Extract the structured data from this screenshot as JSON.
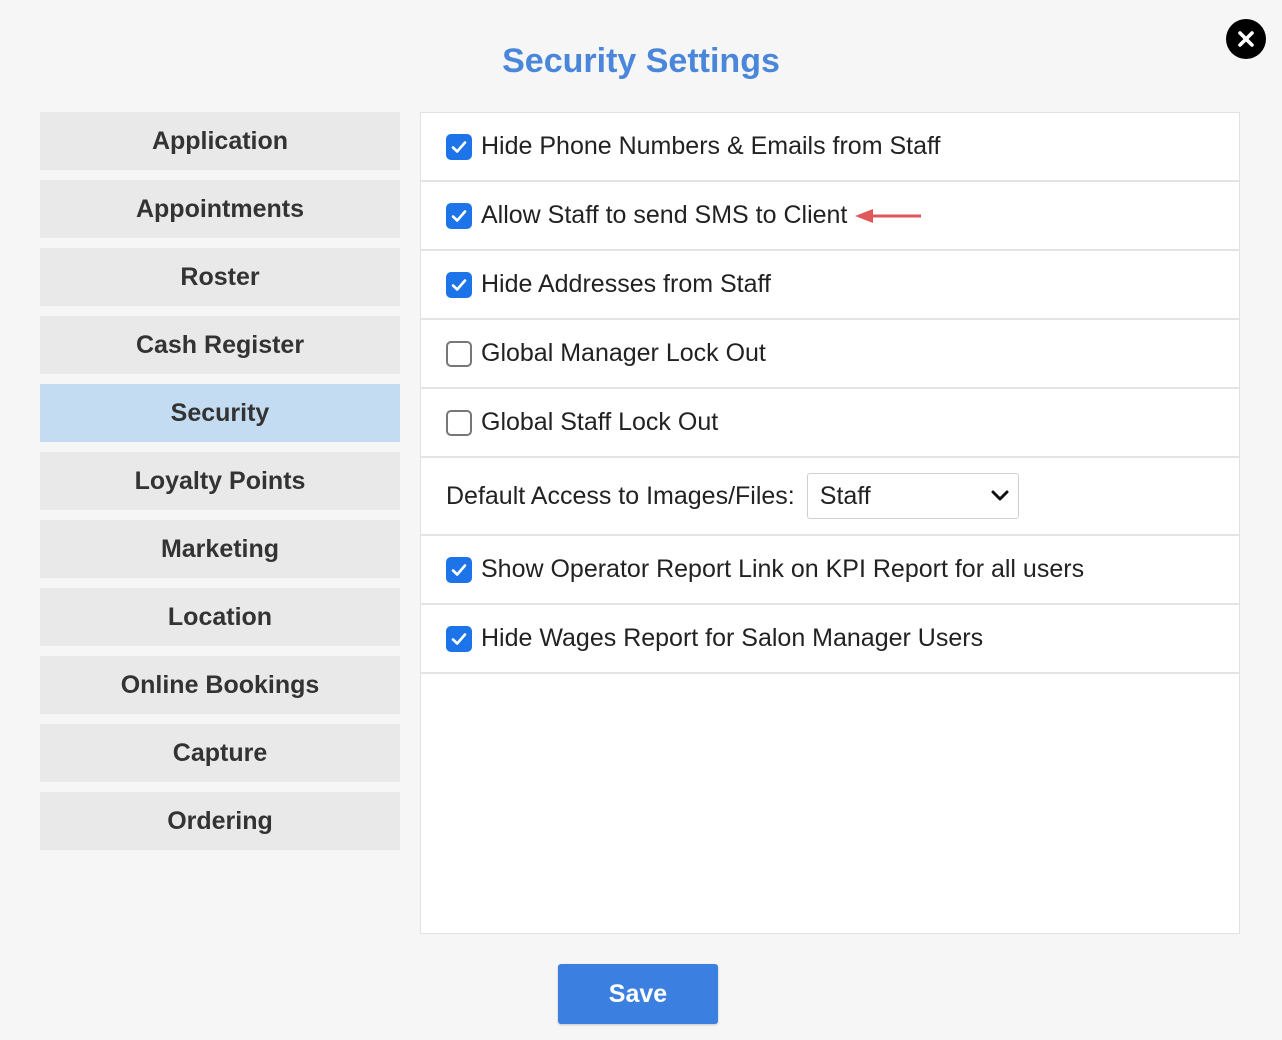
{
  "dialog": {
    "title": "Security Settings",
    "close_icon": "close-icon",
    "save_label": "Save"
  },
  "sidebar": {
    "items": [
      {
        "label": "Application",
        "active": false
      },
      {
        "label": "Appointments",
        "active": false
      },
      {
        "label": "Roster",
        "active": false
      },
      {
        "label": "Cash Register",
        "active": false
      },
      {
        "label": "Security",
        "active": true
      },
      {
        "label": "Loyalty Points",
        "active": false
      },
      {
        "label": "Marketing",
        "active": false
      },
      {
        "label": "Location",
        "active": false
      },
      {
        "label": "Online Bookings",
        "active": false
      },
      {
        "label": "Capture",
        "active": false
      },
      {
        "label": "Ordering",
        "active": false
      }
    ]
  },
  "settings": {
    "options": [
      {
        "label": "Hide Phone Numbers & Emails from Staff",
        "checked": true
      },
      {
        "label": "Allow Staff to send SMS to Client",
        "checked": true,
        "annotation": "red-arrow-left"
      },
      {
        "label": "Hide Addresses from Staff",
        "checked": true
      },
      {
        "label": "Global Manager Lock Out",
        "checked": false
      },
      {
        "label": "Global Staff Lock Out",
        "checked": false
      }
    ],
    "default_access": {
      "label": "Default Access to Images/Files:",
      "selected": "Staff"
    },
    "more_options": [
      {
        "label": "Show Operator Report Link on KPI Report for all users",
        "checked": true
      },
      {
        "label": "Hide Wages Report for Salon Manager Users",
        "checked": true
      }
    ]
  },
  "colors": {
    "title": "#4a86d9",
    "active_nav": "#c4dcf1",
    "checkbox_checked": "#1c74e8",
    "save_button": "#3b80e0",
    "annotation_arrow": "#e0585a"
  }
}
